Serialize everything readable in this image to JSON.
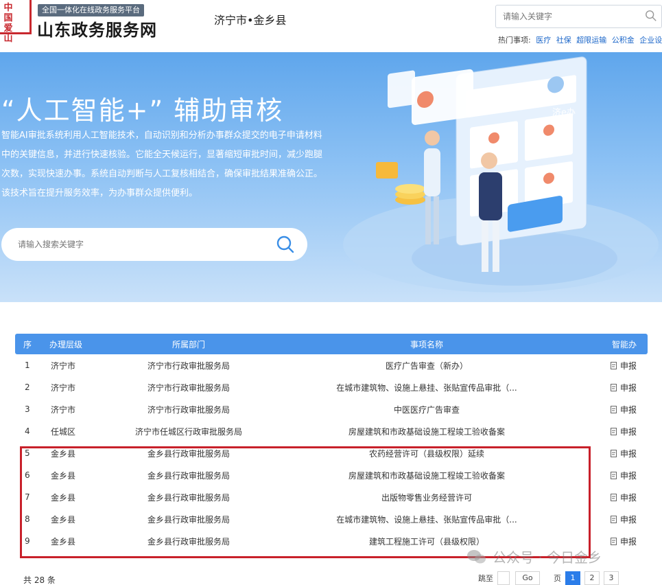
{
  "header": {
    "seal_chars": [
      "中",
      "国",
      "爱",
      "山"
    ],
    "platform_tag": "全国一体化在线政务服务平台",
    "site_name": "山东政务服务网",
    "region": "济宁市•金乡县",
    "search_placeholder": "请输入关键字",
    "hot_label": "热门事项:",
    "hot_items": [
      "医疗",
      "社保",
      "超限运输",
      "公积金",
      "企业设立"
    ]
  },
  "banner": {
    "title": "“人工智能+” 辅助审核",
    "desc": "智能AI审批系统利用人工智能技术，自动识别和分析办事群众提交的电子申请材料中的关键信息，并进行快速核验。它能全天候运行，显著缩短审批时间，减少跑腿次数，实现快速办事。系统自动判断与人工复核相结合，确保审批结果准确公正。该技术旨在提升服务效率，为办事群众提供便利。",
    "search_placeholder": "请输入搜索关键字",
    "illus_badge": "济e办"
  },
  "table": {
    "headers": [
      "序",
      "办理层级",
      "所属部门",
      "事项名称",
      "智能办"
    ],
    "rows": [
      {
        "no": "1",
        "level": "济宁市",
        "dept": "济宁市行政审批服务局",
        "item": "医疗广告审查（新办）",
        "action": "申报"
      },
      {
        "no": "2",
        "level": "济宁市",
        "dept": "济宁市行政审批服务局",
        "item": "在城市建筑物、设施上悬挂、张贴宣传品审批（...",
        "action": "申报"
      },
      {
        "no": "3",
        "level": "济宁市",
        "dept": "济宁市行政审批服务局",
        "item": "中医医疗广告审查",
        "action": "申报"
      },
      {
        "no": "4",
        "level": "任城区",
        "dept": "济宁市任城区行政审批服务局",
        "item": "房屋建筑和市政基础设施工程竣工验收备案",
        "action": "申报"
      },
      {
        "no": "5",
        "level": "金乡县",
        "dept": "金乡县行政审批服务局",
        "item": "农药经营许可（县级权限）延续",
        "action": "申报"
      },
      {
        "no": "6",
        "level": "金乡县",
        "dept": "金乡县行政审批服务局",
        "item": "房屋建筑和市政基础设施工程竣工验收备案",
        "action": "申报"
      },
      {
        "no": "7",
        "level": "金乡县",
        "dept": "金乡县行政审批服务局",
        "item": "出版物零售业务经营许可",
        "action": "申报"
      },
      {
        "no": "8",
        "level": "金乡县",
        "dept": "金乡县行政审批服务局",
        "item": "在城市建筑物、设施上悬挂、张贴宣传品审批（...",
        "action": "申报"
      },
      {
        "no": "9",
        "level": "金乡县",
        "dept": "金乡县行政审批服务局",
        "item": "建筑工程施工许可（县级权限）",
        "action": "申报"
      }
    ]
  },
  "footer": {
    "total": "共 28 条",
    "jump_label": "跳至",
    "go_label": "Go",
    "page_label": "页",
    "pages": [
      "1",
      "2",
      "3"
    ],
    "current_page": "1"
  },
  "watermark": "公众号 · 今日金乡",
  "colors": {
    "accent": "#4a94ea",
    "highlight": "#c8202a",
    "seal": "#c8282e"
  }
}
